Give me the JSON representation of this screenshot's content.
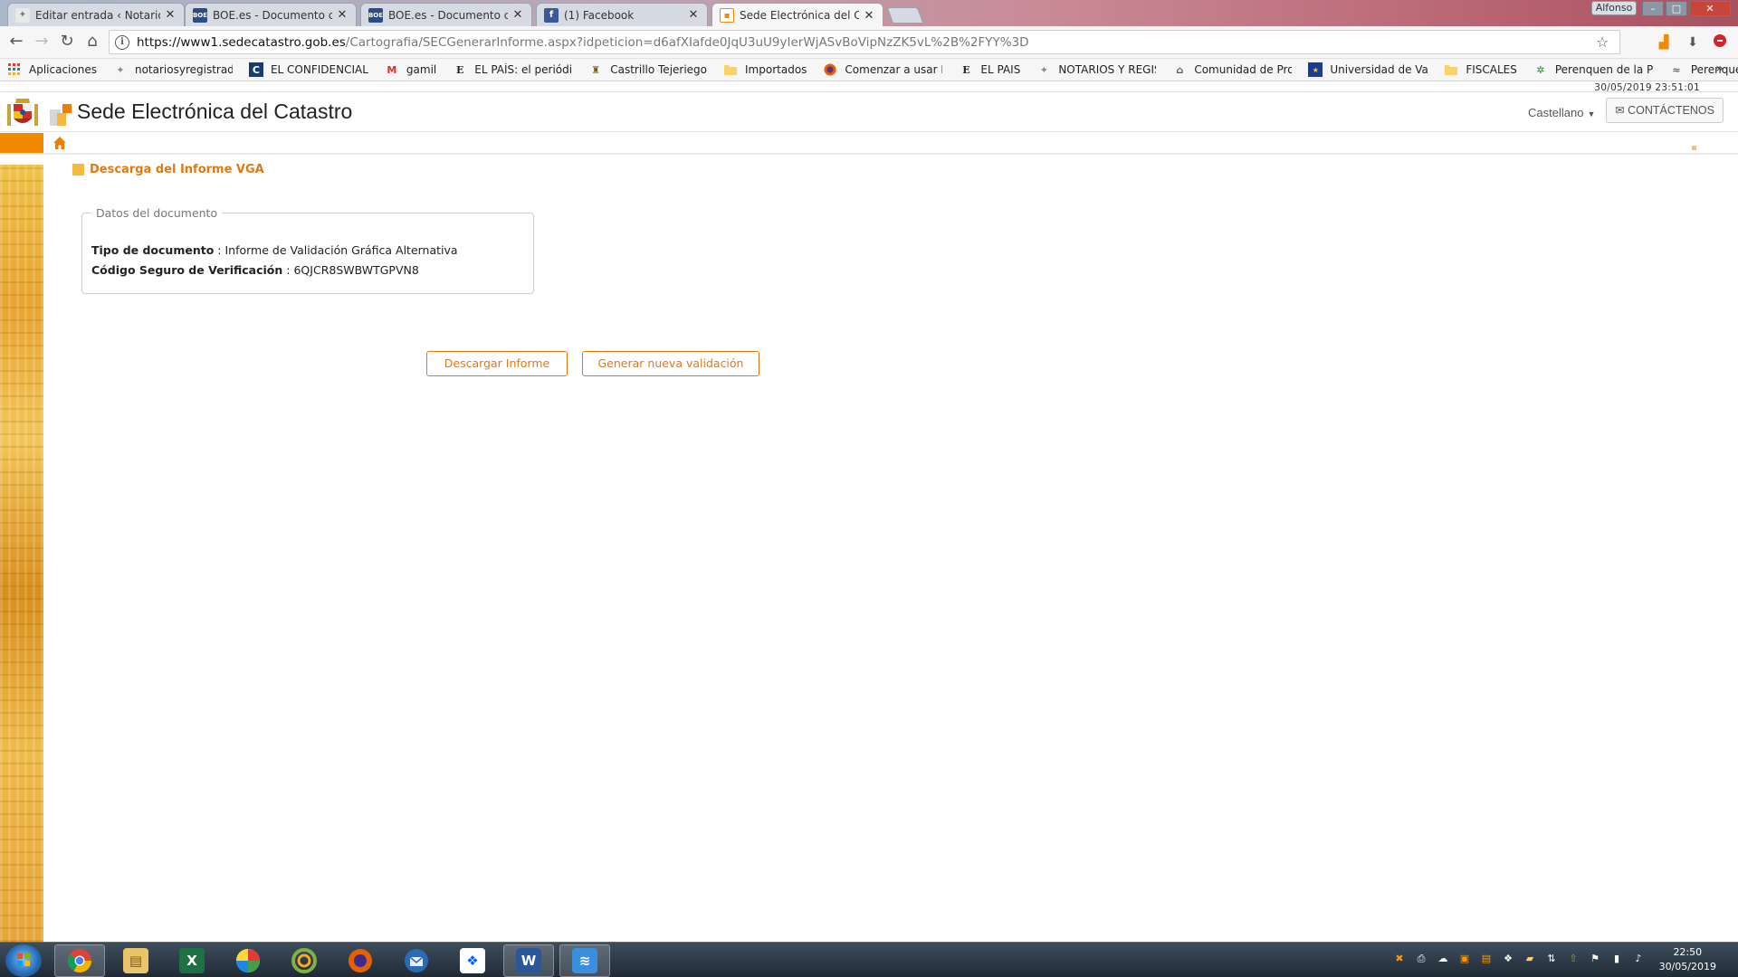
{
  "browser": {
    "tabs": [
      {
        "title": "Editar entrada ‹ Notarios",
        "favicon": "notarios-icon",
        "active": false
      },
      {
        "title": "BOE.es - Documento con",
        "favicon": "boe-icon",
        "active": false
      },
      {
        "title": "BOE.es - Documento con",
        "favicon": "boe-icon",
        "active": false
      },
      {
        "title": "(1) Facebook",
        "favicon": "facebook-icon",
        "active": false
      },
      {
        "title": "Sede Electrónica del Cata",
        "favicon": "catastro-icon",
        "active": true
      }
    ],
    "close_glyph": "✕",
    "user_name": "Alfonso",
    "window_buttons": {
      "minimize": "–",
      "maximize": "□",
      "close": "✕"
    },
    "url": {
      "host": "https://www1.sedecatastro.gob.es",
      "path": "/Cartografia/SECGenerarInforme.aspx?idpeticion=d6afXIafde0JqU3uU9yIerWjASvBoVipNzZK5vL%2B%2FYY%3D"
    },
    "nav_glyphs": {
      "back": "←",
      "forward": "→",
      "reload": "↻",
      "home": "⌂",
      "star": "☆",
      "info": "i"
    },
    "bookmarks": [
      {
        "label": "Aplicaciones",
        "icon": "apps-grid-icon"
      },
      {
        "label": "notariosyregistrador",
        "icon": "notarios-icon"
      },
      {
        "label": "EL CONFIDENCIAL",
        "icon": "confidencial-icon"
      },
      {
        "label": "gamil",
        "icon": "gmail-icon"
      },
      {
        "label": "EL PAÍS: el periódico",
        "icon": "elpais-icon"
      },
      {
        "label": "Castrillo Tejeriego",
        "icon": "castrillo-icon"
      },
      {
        "label": "Importados",
        "icon": "folder-icon"
      },
      {
        "label": "Comenzar a usar Fir",
        "icon": "firefox-icon"
      },
      {
        "label": "EL PAIS",
        "icon": "elpais-icon"
      },
      {
        "label": "NOTARIOS Y REGIST",
        "icon": "notarios-icon"
      },
      {
        "label": "Comunidad de Prop",
        "icon": "building-icon"
      },
      {
        "label": "Universidad de Valla",
        "icon": "eu-flag-icon"
      },
      {
        "label": "FISCALES",
        "icon": "folder-icon"
      },
      {
        "label": "Perenquen de la Paz",
        "icon": "joomla-icon"
      },
      {
        "label": "Perenquen",
        "icon": "lizard-icon"
      }
    ],
    "bookmarks_more": "»"
  },
  "site": {
    "datetime": "30/05/2019  23:51:01",
    "title": "Sede Electrónica del Catastro",
    "language": "Castellano",
    "language_caret": "▼",
    "contact_label": "CONTÁCTENOS",
    "contact_icon": "✉"
  },
  "main": {
    "section_title": "Descarga del Informe VGA",
    "fieldset_legend": "Datos del documento",
    "fields": [
      {
        "key": "Tipo de documento",
        "sep": " : ",
        "value": "Informe de Validación Gráfica Alternativa"
      },
      {
        "key": "Código Seguro de Verificación",
        "sep": " : ",
        "value": "6QJCR8SWBWTGPVN8"
      }
    ],
    "buttons": {
      "download": "Descargar Informe",
      "new_validation": "Generar nueva validación"
    }
  },
  "taskbar": {
    "apps": [
      "chrome-icon",
      "explorer-icon",
      "excel-icon",
      "picasa-icon",
      "cc-icon",
      "firefox-icon",
      "thunderbird-icon",
      "dropbox-icon",
      "word-icon",
      "app-icon"
    ],
    "clock_time": "22:50",
    "clock_date": "30/05/2019"
  },
  "colors": {
    "accent_orange": "#e07a10",
    "strip_orange": "#f28a00"
  }
}
